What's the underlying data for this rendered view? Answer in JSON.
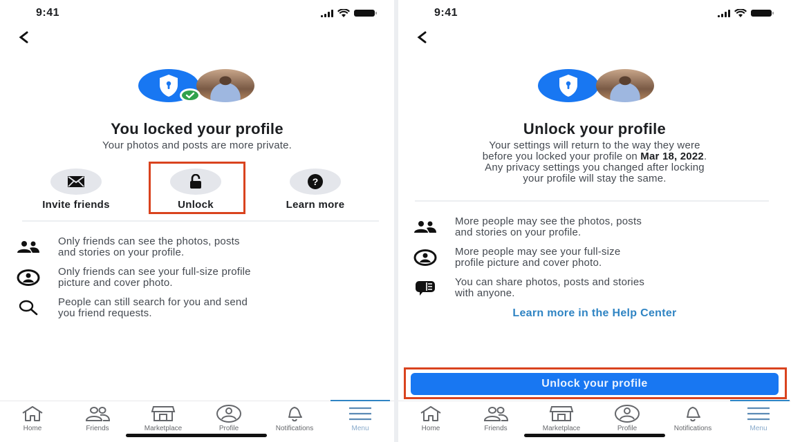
{
  "status_bar": {
    "time": "9:41"
  },
  "left_screen": {
    "title": "You locked your profile",
    "subtitle": "Your photos and posts are more private.",
    "actions": [
      {
        "label": "Invite friends",
        "icon": "envelope-icon"
      },
      {
        "label": "Unlock",
        "icon": "unlock-icon",
        "highlighted": true
      },
      {
        "label": "Learn more",
        "icon": "question-icon"
      }
    ],
    "info_items": [
      {
        "icon": "friends-icon",
        "line1": "Only friends can see the photos, posts",
        "line2": "and stories on your profile."
      },
      {
        "icon": "profile-circle-icon",
        "line1": "Only friends can see your full-size profile",
        "line2": "picture and cover photo."
      },
      {
        "icon": "search-icon",
        "line1": "People can still search for you and send",
        "line2": "you friend requests."
      }
    ]
  },
  "right_screen": {
    "title": "Unlock your profile",
    "subtitle_lines": [
      "Your settings will return to the way they were",
      "before you locked your profile on ",
      "Mar 18, 2022",
      ".",
      "Any privacy settings you changed after locking",
      "your profile will stay the same."
    ],
    "info_items": [
      {
        "icon": "friends-icon",
        "line1": "More people may see the photos, posts",
        "line2": "and stories on your profile."
      },
      {
        "icon": "profile-circle-icon",
        "line1": "More people may see your full-size",
        "line2": "profile picture and cover photo."
      },
      {
        "icon": "share-message-icon",
        "line1": "You can share photos, posts and stories",
        "line2": "with anyone."
      }
    ],
    "help_link": "Learn more in the Help Center",
    "primary_button": "Unlock your profile"
  },
  "tabbar": {
    "tabs": [
      {
        "label": "Home",
        "icon": "home-icon"
      },
      {
        "label": "Friends",
        "icon": "friends-outline-icon"
      },
      {
        "label": "Marketplace",
        "icon": "marketplace-icon"
      },
      {
        "label": "Profile",
        "icon": "profile-icon"
      },
      {
        "label": "Notifications",
        "icon": "bell-icon"
      },
      {
        "label": "Menu",
        "icon": "menu-icon",
        "active": true
      }
    ]
  },
  "colors": {
    "brand_blue": "#1877f2",
    "highlight_red": "#d9431e",
    "check_green": "#31a24c",
    "link_blue": "#2f84c3"
  }
}
